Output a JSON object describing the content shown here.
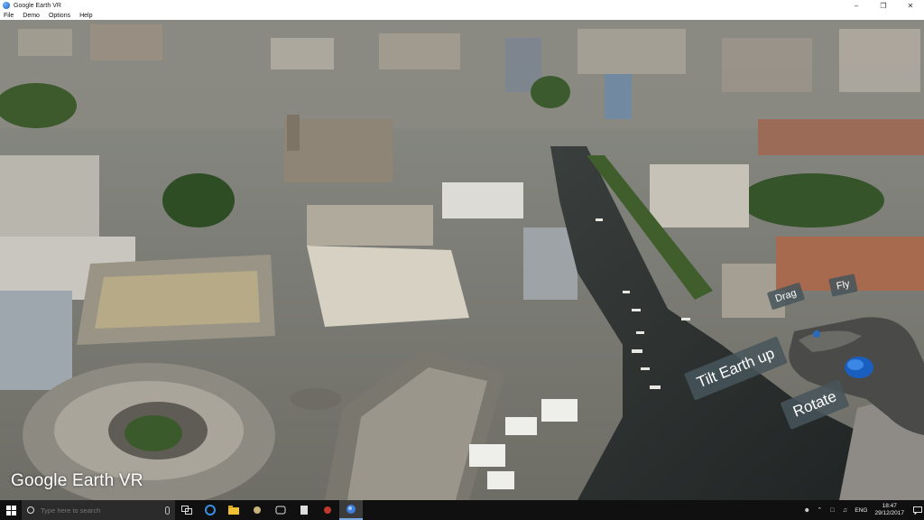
{
  "window": {
    "title": "Google Earth VR",
    "minimize_icon": "minimize-icon",
    "restore_icon": "restore-icon",
    "close_icon": "close-icon"
  },
  "menu": [
    "File",
    "Demo",
    "Options",
    "Help"
  ],
  "viewport": {
    "watermark_google": "Google",
    "watermark_earthvr": "Earth VR",
    "controller_labels": {
      "drag": "Drag",
      "fly": "Fly",
      "tilt": "Tilt Earth up",
      "rotate": "Rotate"
    },
    "label_color": "#46555a"
  },
  "taskbar": {
    "search_placeholder": "Type here to search",
    "icons": [
      "windows-start-icon",
      "search-icon",
      "microphone-icon",
      "task-view-icon",
      "edge-icon",
      "file-explorer-icon",
      "app-icon-1",
      "app-icon-2",
      "app-icon-3",
      "app-icon-4",
      "google-earth-vr-icon"
    ],
    "language": "ENG",
    "time": "18:47",
    "date": "29/12/2017"
  }
}
